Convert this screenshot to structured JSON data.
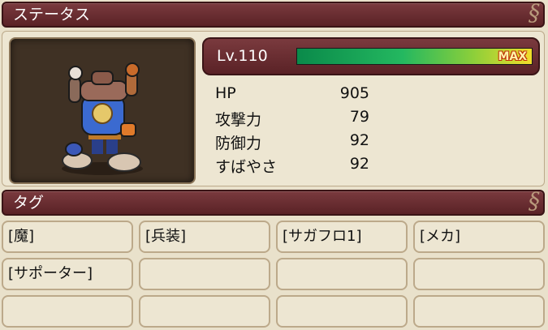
{
  "status_header": {
    "title": "ステータス"
  },
  "level": {
    "label": "Lv.110",
    "exp_fraction": 1.0,
    "max_label": "MAX"
  },
  "stats": [
    {
      "label": "HP",
      "value": "905"
    },
    {
      "label": "攻撃力",
      "value": "79"
    },
    {
      "label": "防御力",
      "value": "92"
    },
    {
      "label": "すばやさ",
      "value": "92"
    }
  ],
  "tags_header": {
    "title": "タグ"
  },
  "tags": [
    "[魔]",
    "[兵装]",
    "[サガフロ1]",
    "[メカ]",
    "[サポーター]",
    "",
    "",
    "",
    "",
    "",
    "",
    ""
  ]
}
